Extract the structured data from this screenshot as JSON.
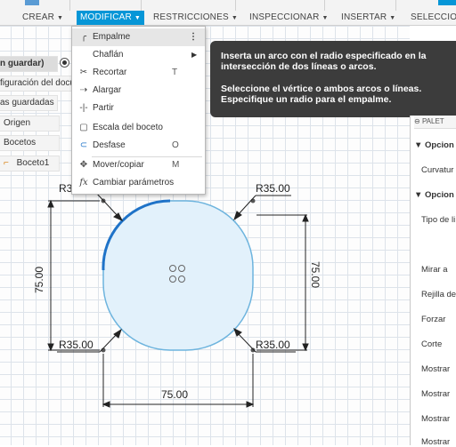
{
  "toolbar": {
    "crear": "CREAR",
    "modificar": "MODIFICAR",
    "restricciones": "RESTRICCIONES",
    "inspeccionar": "INSPECCIONAR",
    "insertar": "INSERTAR",
    "seleccion": "SELECCION",
    "caret": "▼",
    "accent_color": "#0696d7"
  },
  "browser": {
    "rows": [
      "n guardar)",
      "figuración del docu",
      "as guardadas",
      "Origen",
      "Bocetos",
      "Boceto1"
    ]
  },
  "menu": {
    "items": [
      {
        "icon": "fillet-icon",
        "label": "Empalme",
        "shortcut": "",
        "more": "⋮"
      },
      {
        "icon": "chamfer-icon",
        "label": "Chaflán",
        "arrow": "▶"
      },
      {
        "icon": "trim-icon",
        "label": "Recortar",
        "shortcut": "T"
      },
      {
        "icon": "extend-icon",
        "label": "Alargar",
        "shortcut": ""
      },
      {
        "icon": "break-icon",
        "label": "Partir",
        "shortcut": ""
      },
      {
        "icon": "sketch-scale-icon",
        "label": "Escala del boceto",
        "shortcut": ""
      },
      {
        "icon": "offset-icon",
        "label": "Desfase",
        "shortcut": "O"
      },
      {
        "icon": "move-copy-icon",
        "label": "Mover/copiar",
        "shortcut": "M"
      },
      {
        "icon": "change-parameters-icon",
        "label": "Cambiar parámetros",
        "shortcut": ""
      }
    ]
  },
  "tooltip": {
    "line1": "Inserta un arco con el radio especificado en la",
    "line2": "intersección de dos líneas o arcos.",
    "line3": "Seleccione el vértice o ambos arcos o líneas.",
    "line4": "Especifique un radio para el empalme."
  },
  "sketch": {
    "dim_top_left": "R3",
    "dim_top_right": "R35.00",
    "dim_bottom_left": "R35.00",
    "dim_bottom_right": "R35.00",
    "dim_left": "75.00",
    "dim_right": "75.00",
    "dim_bottom": "75.00",
    "fill_color": "#e2f1fb",
    "outline_color": "#6db4de",
    "highlight_color": "#1f73c8"
  },
  "right_panel": {
    "header": "PALET",
    "section1": "Opcion",
    "curvatura": "Curvatur",
    "section2": "Opcion",
    "tipo": "Tipo de li",
    "mirar": "Mirar a",
    "rejilla": "Rejilla de",
    "forzar": "Forzar",
    "corte": "Corte",
    "mostrar1": "Mostrar",
    "mostrar2": "Mostrar",
    "mostrar3": "Mostrar",
    "mostrar4": "Mostrar"
  }
}
